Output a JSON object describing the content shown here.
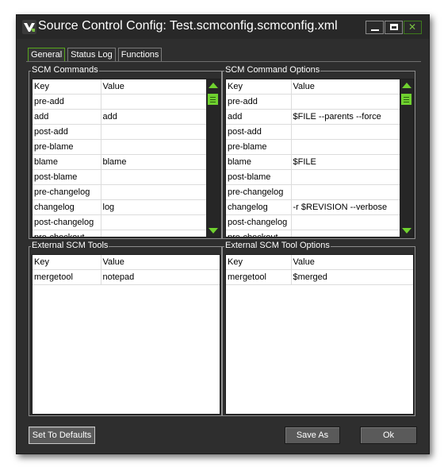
{
  "window": {
    "title": "Source Control Config: Test.scmconfig.scmconfig.xml",
    "minimize_label": "",
    "close_glyph": "✕"
  },
  "tabs": [
    {
      "label": "General",
      "active": true
    },
    {
      "label": "Status Log",
      "active": false
    },
    {
      "label": "Functions",
      "active": false
    }
  ],
  "scm_commands": {
    "title": "SCM Commands",
    "columns": [
      "Key",
      "Value"
    ],
    "rows": [
      [
        "pre-add",
        ""
      ],
      [
        "add",
        "add"
      ],
      [
        "post-add",
        ""
      ],
      [
        "pre-blame",
        ""
      ],
      [
        "blame",
        "blame"
      ],
      [
        "post-blame",
        ""
      ],
      [
        "pre-changelog",
        ""
      ],
      [
        "changelog",
        "log"
      ],
      [
        "post-changelog",
        ""
      ],
      [
        "pre-checkout",
        ""
      ]
    ]
  },
  "scm_command_options": {
    "title": "SCM Command Options",
    "columns": [
      "Key",
      "Value"
    ],
    "rows": [
      [
        "pre-add",
        ""
      ],
      [
        "add",
        "$FILE --parents --force"
      ],
      [
        "post-add",
        ""
      ],
      [
        "pre-blame",
        ""
      ],
      [
        "blame",
        "$FILE"
      ],
      [
        "post-blame",
        ""
      ],
      [
        "pre-changelog",
        ""
      ],
      [
        "changelog",
        "-r $REVISION --verbose"
      ],
      [
        "post-changelog",
        ""
      ],
      [
        "pre-checkout",
        ""
      ]
    ]
  },
  "external_tools": {
    "title": "External SCM Tools",
    "columns": [
      "Key",
      "Value"
    ],
    "rows": [
      [
        "mergetool",
        "notepad"
      ]
    ]
  },
  "external_tool_options": {
    "title": "External SCM Tool Options",
    "columns": [
      "Key",
      "Value"
    ],
    "rows": [
      [
        "mergetool",
        "$merged"
      ]
    ]
  },
  "buttons": {
    "defaults": "Set To Defaults",
    "save_as": "Save As",
    "ok": "Ok"
  },
  "colors": {
    "accent": "#6fd12f",
    "background": "#2e2e2e",
    "titlebar": "#282828"
  }
}
